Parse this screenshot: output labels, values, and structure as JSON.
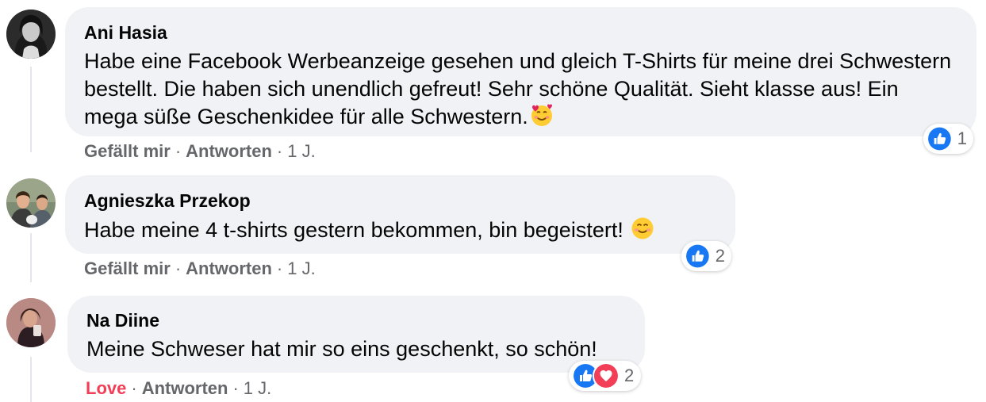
{
  "comments": [
    {
      "author": "Ani Hasia",
      "text": "Habe eine Facebook Werbeanzeige gesehen und gleich T-Shirts für meine drei Schwestern bestellt. Die haben sich unendlich gefreut! Sehr schöne Qualität. Sieht klasse aus! Ein mega süße Geschenkidee für alle Schwestern.",
      "emoji": "smiling-face-with-hearts-icon",
      "like_label": "Gefällt mir",
      "reply_label": "Antworten",
      "time": "1 J.",
      "reaction_count": "1",
      "reactions": [
        "like"
      ]
    },
    {
      "author": "Agnieszka Przekop",
      "text": "Habe meine 4 t-shirts gestern bekommen, bin begeistert!",
      "emoji": "smiling-face-icon",
      "like_label": "Gefällt mir",
      "reply_label": "Antworten",
      "time": "1 J.",
      "reaction_count": "2",
      "reactions": [
        "like"
      ]
    },
    {
      "author": "Na Diine",
      "text": "Meine Schweser hat mir so eins geschenkt, so schön!",
      "like_label": "Love",
      "reply_label": "Antworten",
      "time": "1 J.",
      "reaction_count": "2",
      "reactions": [
        "like",
        "love"
      ]
    }
  ],
  "separator": "·",
  "colors": {
    "bubble": "#f0f2f5",
    "meta_text": "#65676b",
    "like_blue": "#1877f2",
    "love_red": "#f33e58"
  }
}
